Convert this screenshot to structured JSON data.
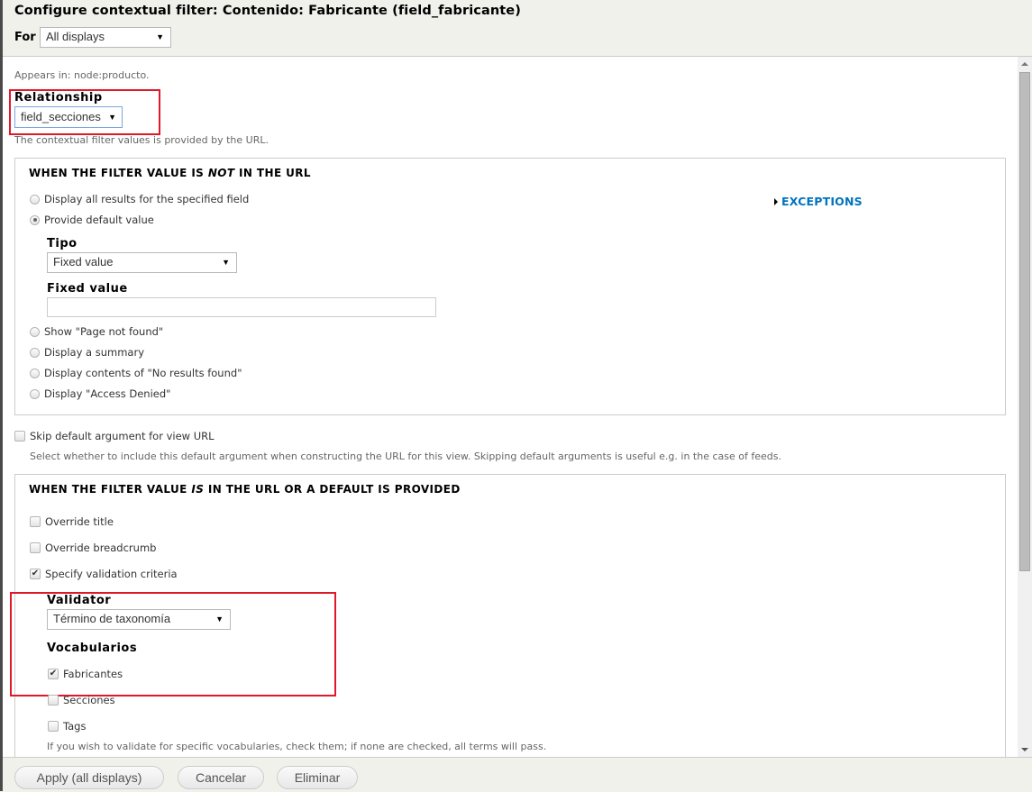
{
  "header": {
    "title": "Configure contextual filter: Contenido: Fabricante (field_fabricante)",
    "for_label": "For",
    "for_select": "All displays"
  },
  "appears_in": "Appears in: node:producto.",
  "relationship": {
    "label": "Relationship",
    "value": "field_secciones",
    "description": "The contextual filter values is provided by the URL."
  },
  "not_in_url": {
    "legend_pre": "WHEN THE FILTER VALUE IS ",
    "legend_em": "NOT",
    "legend_post": " IN THE URL",
    "options": [
      {
        "label": "Display all results for the specified field",
        "checked": false
      },
      {
        "label": "Provide default value",
        "checked": true
      },
      {
        "label": "Show \"Page not found\"",
        "checked": false
      },
      {
        "label": "Display a summary",
        "checked": false
      },
      {
        "label": "Display contents of \"No results found\"",
        "checked": false
      },
      {
        "label": "Display \"Access Denied\"",
        "checked": false
      }
    ],
    "tipo_label": "Tipo",
    "tipo_value": "Fixed value",
    "fixed_value_label": "Fixed value",
    "fixed_value": "",
    "exceptions_label": "EXCEPTIONS"
  },
  "skip_default": {
    "label": "Skip default argument for view URL",
    "checked": false,
    "description": "Select whether to include this default argument when constructing the URL for this view. Skipping default arguments is useful e.g. in the case of feeds."
  },
  "is_in_url": {
    "legend_pre": "WHEN THE FILTER VALUE ",
    "legend_em": "IS",
    "legend_post": " IN THE URL OR A DEFAULT IS PROVIDED",
    "checkboxes": [
      {
        "label": "Override title",
        "checked": false
      },
      {
        "label": "Override breadcrumb",
        "checked": false
      },
      {
        "label": "Specify validation criteria",
        "checked": true
      }
    ],
    "validator_label": "Validator",
    "validator_value": "Término de taxonomía",
    "vocab_label": "Vocabularios",
    "vocabularies": [
      {
        "label": "Fabricantes",
        "checked": true
      },
      {
        "label": "Secciones",
        "checked": false
      },
      {
        "label": "Tags",
        "checked": false
      }
    ],
    "vocab_description": "If you wish to validate for specific vocabularies, check them; if none are checked, all terms will pass."
  },
  "footer": {
    "apply": "Apply (all displays)",
    "cancel": "Cancelar",
    "delete": "Eliminar"
  },
  "colors": {
    "highlight": "#e0192a",
    "link": "#0074bd"
  }
}
